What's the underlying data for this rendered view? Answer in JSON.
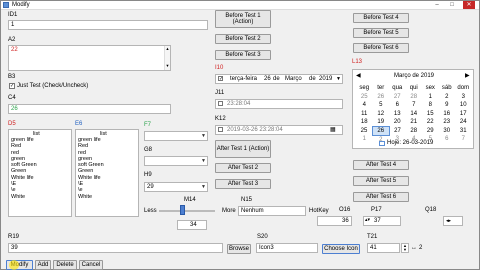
{
  "window": {
    "title": "Modify",
    "min": "–",
    "max": "□",
    "close": "✕"
  },
  "labels": {
    "id1": "ID1",
    "a2": "A2",
    "b3": "B3",
    "c4": "C4",
    "d5": "D5",
    "e6": "E6",
    "f7": "F7",
    "g8": "G8",
    "h9": "H9",
    "i10": "I10",
    "j11": "J11",
    "k12": "K12",
    "l13": "L13",
    "m14": "M14",
    "n15": "N15",
    "o16": "O16",
    "p17": "P17",
    "q18": "Q18",
    "r19": "R19",
    "s20": "S20",
    "t21": "T21"
  },
  "fields": {
    "id1_value": "1",
    "a2_value": "22",
    "b3_label": "Just Test (Check/Uncheck)",
    "c4_value": "26",
    "h9_value": "29",
    "m14_value": "34",
    "n15_value": "Nenhum",
    "o16_value": "36",
    "p17_value": "37",
    "r19_value": "39",
    "s20_value": "Icon3",
    "t21_value": "41",
    "t21_side": "2",
    "less_label": "Less",
    "more_label": "More",
    "hotkey_label": "HotKey",
    "i10_day": "terça-feira",
    "i10_date": "26",
    "i10_de1": "de",
    "i10_month": "Março",
    "i10_de2": "de",
    "i10_year": "2019",
    "j11_value": "23:28:04",
    "k12_value": "2019-03-26 23:28:04"
  },
  "lists": {
    "d5_header": "list",
    "d5_items": [
      "green life",
      "Red",
      "red",
      "green",
      "soft Green",
      "Green",
      "White life",
      "\\E",
      "\\e",
      "White"
    ],
    "e6_header": "list",
    "e6_items": [
      "green life",
      "Red",
      "red",
      "green",
      "soft Green",
      "Green",
      "White life",
      "\\E",
      "\\e",
      "White"
    ]
  },
  "buttons": {
    "before1": "Before Test 1 (Action)",
    "before2": "Before Test 2",
    "before3": "Before Test 3",
    "before4": "Before Test 4",
    "before5": "Before Test 5",
    "before6": "Before Test 6",
    "after1": "After Test 1 (Action)",
    "after2": "After Test 2",
    "after3": "After Test 3",
    "after4": "After Test 4",
    "after5": "After Test 5",
    "after6": "After Test 6",
    "browse": "Browse",
    "choose_icon": "Choose Icon",
    "modify": "Modify",
    "add": "Add",
    "delete": "Delete",
    "cancel": "Cancel"
  },
  "calendar": {
    "header": "Março de 2019",
    "prev": "◀",
    "next": "▶",
    "weekdays": [
      "seg",
      "ter",
      "qua",
      "qui",
      "sex",
      "sáb",
      "dom"
    ],
    "rows": [
      [
        "25",
        "26",
        "27",
        "28",
        "1",
        "2",
        "3"
      ],
      [
        "4",
        "5",
        "6",
        "7",
        "8",
        "9",
        "10"
      ],
      [
        "11",
        "12",
        "13",
        "14",
        "15",
        "16",
        "17"
      ],
      [
        "18",
        "19",
        "20",
        "21",
        "22",
        "23",
        "24"
      ],
      [
        "25",
        "26",
        "27",
        "28",
        "29",
        "30",
        "31"
      ],
      [
        "1",
        "2",
        "3",
        "4",
        "5",
        "6",
        "7"
      ]
    ],
    "today": "Hoje: 26-03-2019"
  }
}
